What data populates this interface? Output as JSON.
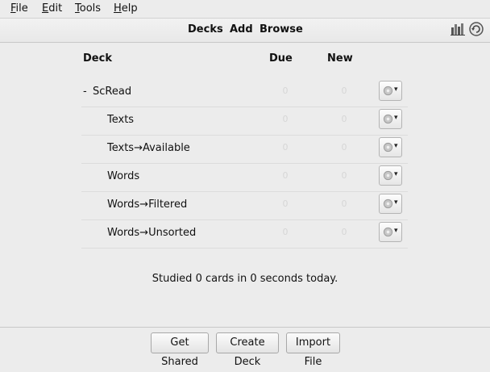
{
  "menu": {
    "file": {
      "u": "F",
      "rest": "ile"
    },
    "edit": {
      "u": "E",
      "rest": "dit"
    },
    "tools": {
      "u": "T",
      "rest": "ools"
    },
    "help": {
      "u": "H",
      "rest": "elp"
    }
  },
  "toolbar": {
    "decks": "Decks",
    "add": "Add",
    "browse": "Browse",
    "stats_icon": "bar-chart-icon",
    "sync_icon": "sync-icon"
  },
  "table": {
    "headers": {
      "deck": "Deck",
      "due": "Due",
      "new": "New"
    },
    "rows": [
      {
        "collapse": "-",
        "name": "ScRead",
        "due": "0",
        "new": "0"
      },
      {
        "name": "Texts",
        "due": "0",
        "new": "0"
      },
      {
        "name": "Texts→Available",
        "due": "0",
        "new": "0"
      },
      {
        "name": "Words",
        "due": "0",
        "new": "0"
      },
      {
        "name": "Words→Filtered",
        "due": "0",
        "new": "0"
      },
      {
        "name": "Words→Unsorted",
        "due": "0",
        "new": "0"
      }
    ],
    "options_icon": "gear-icon",
    "options_arrow": "▾"
  },
  "studied": "Studied 0 cards in 0 seconds today.",
  "bottom": {
    "get_shared": "Get Shared",
    "create_deck": "Create Deck",
    "import_file": "Import File"
  },
  "colors": {
    "muted_count": "#d6d6d6",
    "background": "#ececec"
  }
}
